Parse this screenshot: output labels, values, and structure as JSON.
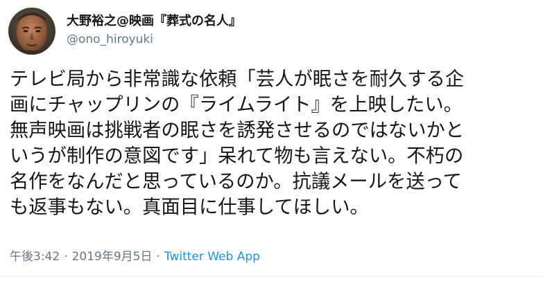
{
  "author": {
    "display_name": "大野裕之@映画『葬式の名人』",
    "handle": "@ono_hiroyuki",
    "avatar_icon": "profile-photo-avatar-icon"
  },
  "tweet": {
    "lines": [
      "テレビ局から非常識な依頼「芸人が眠さを耐久する企",
      "画にチャップリンの『ライムライト』を上映したい。",
      "無声映画は挑戦者の眠さを誘発させるのではないかと",
      "いうが制作の意図です」呆れて物も言えない。不朽の",
      "名作をなんだと思っているのか。抗議メールを送って",
      "も返事もない。真面目に仕事してほしい。"
    ]
  },
  "meta": {
    "time": "午後3:42",
    "separator": "·",
    "date": "2019年9月5日",
    "source": "Twitter Web App"
  },
  "colors": {
    "text": "#14171a",
    "secondary": "#657786",
    "link": "#1b95e0",
    "divider": "#e6ecf0"
  }
}
